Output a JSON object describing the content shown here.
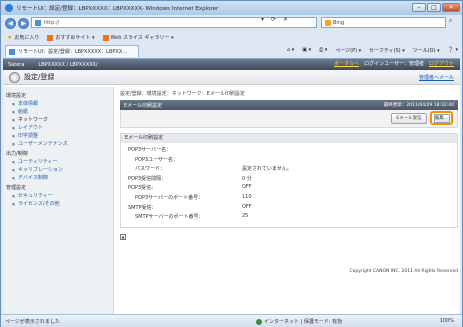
{
  "window": {
    "title": "リモートUI：設定/登録：LBPXXXXX：LBPXXXXX- Windows Internet Explorer",
    "min": "–",
    "max": "□",
    "close": "✕"
  },
  "address": {
    "url": "http://",
    "search_placeholder": "Bing",
    "tools": [
      "▾",
      "⟳",
      "✕"
    ]
  },
  "favorites": {
    "label": "お気に入り",
    "items": [
      "おすすめサイト ▾",
      "Web スライス ギャラリー ▾"
    ]
  },
  "tab": {
    "label": "リモートUI：設定/登録：LBPXXXXX：LBPXX..."
  },
  "command_bar": [
    "ページ(P) ▾",
    "セーフティ(S) ▾",
    "ツール(O) ▾",
    "❓ ▾"
  ],
  "site": {
    "brand": "Satera",
    "device": "LBPXXXXX / LBPXXXXX/",
    "links": [
      "ポータルへ",
      "ログインユーザー：管理者",
      "ログアウト"
    ],
    "page_title": "設定/登録",
    "manager_link": "管理者へメール"
  },
  "sidebar": {
    "groups": [
      {
        "label": "環境設定",
        "items": [
          "本体情報",
          "給紙",
          "ネットワーク",
          "レイアウト",
          "印字調整",
          "ユーザーメンテナンス"
        ]
      },
      {
        "label": "出力/制御",
        "items": [
          "ユーティリティー",
          "キャリブレーション",
          "デバイス制御"
        ]
      },
      {
        "label": "管理設定",
        "items": [
          "セキュリティー",
          "ライセンス/その他"
        ]
      }
    ],
    "active": "ネットワーク"
  },
  "main": {
    "breadcrumb": "設定/登録：環境設定：ネットワーク：Eメール印刷設定",
    "panel_title": "Eメール印刷設定",
    "updated": "最終更新：2011/04/29 18:32:40",
    "mail_receive_button": "Eメール受信",
    "edit_button": "編集...",
    "section_title": "Eメール印刷設定",
    "rows": [
      {
        "key": "POP3サーバー名：",
        "value": "",
        "indent": 0
      },
      {
        "key": "POP3ユーザー名：",
        "value": "",
        "indent": 1
      },
      {
        "key": "パスワード：",
        "value": "設定されていません。",
        "indent": 1
      },
      {
        "key": "POP3受信間隔：",
        "value": "0 分",
        "indent": 0
      },
      {
        "key": "POP3受信：",
        "value": "OFF",
        "indent": 0
      },
      {
        "key": "POP3サーバーのポート番号：",
        "value": "110",
        "indent": 1
      },
      {
        "key": "SMTP受信：",
        "value": "OFF",
        "indent": 0
      },
      {
        "key": "SMTPサーバーのポート番号：",
        "value": "25",
        "indent": 1
      }
    ],
    "back_to_top": "▲",
    "copyright": "Copyright CANON INC. 2011 All Rights Reserved"
  },
  "statusbar": {
    "left": "ページが表示されました",
    "zone": "インターネット | 保護モード: 有効",
    "zoom": "100%"
  }
}
